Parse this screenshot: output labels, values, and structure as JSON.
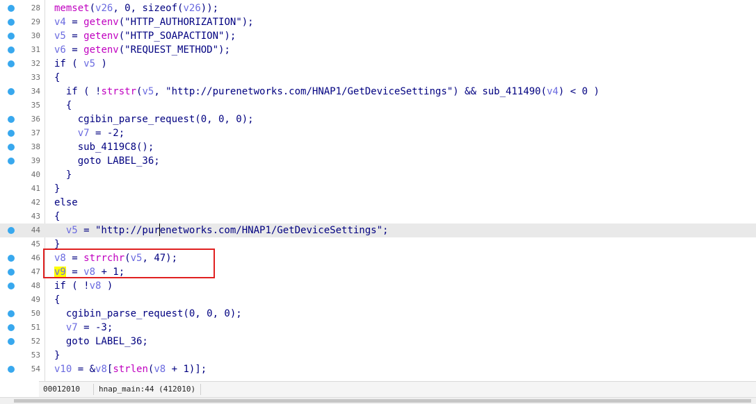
{
  "editor": {
    "lines": [
      {
        "num": "28",
        "segs": [
          {
            "t": "memset",
            "c": "f"
          },
          {
            "t": "(",
            "c": "d"
          },
          {
            "t": "v26",
            "c": "v"
          },
          {
            "t": ", 0, sizeof(",
            "c": "d"
          },
          {
            "t": "v26",
            "c": "v"
          },
          {
            "t": "));",
            "c": "d"
          }
        ]
      },
      {
        "num": "29",
        "segs": [
          {
            "t": "v4",
            "c": "v"
          },
          {
            "t": " = ",
            "c": "d"
          },
          {
            "t": "getenv",
            "c": "f"
          },
          {
            "t": "(",
            "c": "d"
          },
          {
            "t": "\"HTTP_AUTHORIZATION\"",
            "c": "d"
          },
          {
            "t": ");",
            "c": "d"
          }
        ]
      },
      {
        "num": "30",
        "segs": [
          {
            "t": "v5",
            "c": "v"
          },
          {
            "t": " = ",
            "c": "d"
          },
          {
            "t": "getenv",
            "c": "f"
          },
          {
            "t": "(",
            "c": "d"
          },
          {
            "t": "\"HTTP_SOAPACTION\"",
            "c": "d"
          },
          {
            "t": ");",
            "c": "d"
          }
        ]
      },
      {
        "num": "31",
        "segs": [
          {
            "t": "v6",
            "c": "v"
          },
          {
            "t": " = ",
            "c": "d"
          },
          {
            "t": "getenv",
            "c": "f"
          },
          {
            "t": "(",
            "c": "d"
          },
          {
            "t": "\"REQUEST_METHOD\"",
            "c": "d"
          },
          {
            "t": ");",
            "c": "d"
          }
        ]
      },
      {
        "num": "32",
        "segs": [
          {
            "t": "if ( ",
            "c": "d"
          },
          {
            "t": "v5",
            "c": "v"
          },
          {
            "t": " )",
            "c": "d"
          }
        ]
      },
      {
        "num": "33",
        "segs": [
          {
            "t": "{",
            "c": "d"
          }
        ]
      },
      {
        "num": "34",
        "segs": [
          {
            "t": "  if ( !",
            "c": "d"
          },
          {
            "t": "strstr",
            "c": "f"
          },
          {
            "t": "(",
            "c": "d"
          },
          {
            "t": "v5",
            "c": "v"
          },
          {
            "t": ", \"http://purenetworks.com/HNAP1/GetDeviceSettings\") && ",
            "c": "d"
          },
          {
            "t": "sub_411490",
            "c": "d"
          },
          {
            "t": "(",
            "c": "d"
          },
          {
            "t": "v4",
            "c": "v"
          },
          {
            "t": ") < 0 )",
            "c": "d"
          }
        ]
      },
      {
        "num": "35",
        "segs": [
          {
            "t": "  {",
            "c": "d"
          }
        ]
      },
      {
        "num": "36",
        "segs": [
          {
            "t": "    cgibin_parse_request(0, 0, 0);",
            "c": "d"
          }
        ]
      },
      {
        "num": "37",
        "segs": [
          {
            "t": "    ",
            "c": "d"
          },
          {
            "t": "v7",
            "c": "v"
          },
          {
            "t": " = -2;",
            "c": "d"
          }
        ]
      },
      {
        "num": "38",
        "segs": [
          {
            "t": "    sub_4119C8();",
            "c": "d"
          }
        ]
      },
      {
        "num": "39",
        "segs": [
          {
            "t": "    goto LABEL_36;",
            "c": "d"
          }
        ]
      },
      {
        "num": "40",
        "segs": [
          {
            "t": "  }",
            "c": "d"
          }
        ]
      },
      {
        "num": "41",
        "segs": [
          {
            "t": "}",
            "c": "d"
          }
        ]
      },
      {
        "num": "42",
        "segs": [
          {
            "t": "else",
            "c": "d"
          }
        ]
      },
      {
        "num": "43",
        "segs": [
          {
            "t": "{",
            "c": "d"
          }
        ]
      },
      {
        "num": "44",
        "segs": [
          {
            "t": "  ",
            "c": "d"
          },
          {
            "t": "v5",
            "c": "v"
          },
          {
            "t": " = \"http://purenetworks.com/HNAP1/GetDeviceSettings\";",
            "c": "d"
          }
        ]
      },
      {
        "num": "45",
        "segs": [
          {
            "t": "}",
            "c": "d"
          }
        ]
      },
      {
        "num": "46",
        "segs": [
          {
            "t": "v8",
            "c": "v"
          },
          {
            "t": " = ",
            "c": "d"
          },
          {
            "t": "strrchr",
            "c": "f"
          },
          {
            "t": "(",
            "c": "d"
          },
          {
            "t": "v5",
            "c": "v"
          },
          {
            "t": ", 47);",
            "c": "d"
          }
        ]
      },
      {
        "num": "47",
        "segs": [
          {
            "t": "v9",
            "c": "hl"
          },
          {
            "t": " = ",
            "c": "d"
          },
          {
            "t": "v8",
            "c": "v"
          },
          {
            "t": " + 1;",
            "c": "d"
          }
        ]
      },
      {
        "num": "48",
        "segs": [
          {
            "t": "if ( !",
            "c": "d"
          },
          {
            "t": "v8",
            "c": "v"
          },
          {
            "t": " )",
            "c": "d"
          }
        ]
      },
      {
        "num": "49",
        "segs": [
          {
            "t": "{",
            "c": "d"
          }
        ]
      },
      {
        "num": "50",
        "segs": [
          {
            "t": "  cgibin_parse_request(0, 0, 0);",
            "c": "d"
          }
        ]
      },
      {
        "num": "51",
        "segs": [
          {
            "t": "  ",
            "c": "d"
          },
          {
            "t": "v7",
            "c": "v"
          },
          {
            "t": " = -3;",
            "c": "d"
          }
        ]
      },
      {
        "num": "52",
        "segs": [
          {
            "t": "  goto LABEL_36;",
            "c": "d"
          }
        ]
      },
      {
        "num": "53",
        "segs": [
          {
            "t": "}",
            "c": "d"
          }
        ]
      },
      {
        "num": "54",
        "segs": [
          {
            "t": "v10",
            "c": "v"
          },
          {
            "t": " = &",
            "c": "d"
          },
          {
            "t": "v8",
            "c": "v"
          },
          {
            "t": "[",
            "c": "d"
          },
          {
            "t": "strlen",
            "c": "f"
          },
          {
            "t": "(",
            "c": "d"
          },
          {
            "t": "v8",
            "c": "v"
          },
          {
            "t": " + 1)];",
            "c": "d"
          }
        ]
      }
    ],
    "breakpoint_lines": [
      "28",
      "29",
      "30",
      "31",
      "32",
      "34",
      "36",
      "37",
      "38",
      "39",
      "44",
      "46",
      "47",
      "48",
      "50",
      "51",
      "52",
      "54"
    ],
    "current_line": "44"
  },
  "status": {
    "address": "00012010",
    "location": "hnap_main:44 (412010)"
  }
}
